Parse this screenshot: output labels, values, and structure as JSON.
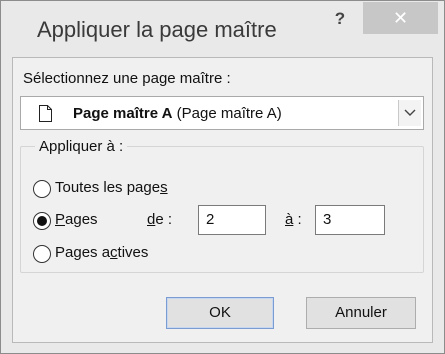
{
  "dialog": {
    "title": "Appliquer la page maître",
    "help_glyph": "?",
    "close_glyph": "✕"
  },
  "master_select": {
    "label": "Sélectionnez une page maître :",
    "selected_bold": "Page maître A",
    "selected_rest": " (Page maître A)",
    "icon": "document-icon"
  },
  "apply_group": {
    "legend": "Appliquer à :",
    "options": [
      {
        "pre": "Toutes les page",
        "ul": "s",
        "post": "",
        "checked": false
      },
      {
        "pre": "",
        "ul": "P",
        "post": "ages",
        "checked": true
      },
      {
        "pre": "Pages a",
        "ul": "c",
        "post": "tives",
        "checked": false
      }
    ],
    "from_label_ul": "d",
    "from_label_rest": "e :",
    "from_value": "2",
    "to_label_ul": "à",
    "to_label_rest": " :",
    "to_value": "3"
  },
  "buttons": {
    "ok": "OK",
    "cancel": "Annuler"
  },
  "colors": {
    "titlebar": "#e9e9e9",
    "client": "#f0f0f0",
    "close_hover": "#c7c7c7"
  }
}
